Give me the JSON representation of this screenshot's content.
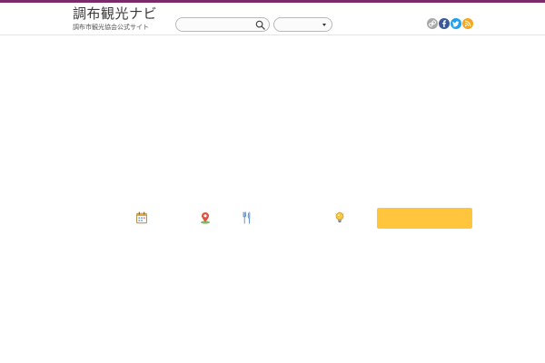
{
  "brand": {
    "stripe_color": "#7b2a6e",
    "title": "調布観光ナビ",
    "subtitle": "調布市観光協会公式サイト"
  },
  "header": {
    "notice": "",
    "search": {
      "placeholder": "",
      "icon": "search-icon"
    },
    "language": {
      "selected": "",
      "icon": "chevron-down-icon"
    },
    "social": [
      {
        "name": "link",
        "icon": "link-icon",
        "color": "#a8a8a8"
      },
      {
        "name": "facebook",
        "icon": "facebook-icon",
        "color": "#3b5998"
      },
      {
        "name": "twitter",
        "icon": "twitter-icon",
        "color": "#1da1f2"
      },
      {
        "name": "rss",
        "icon": "rss-icon",
        "color": "#f5a623"
      }
    ]
  },
  "nav": {
    "items": [
      {
        "label": "",
        "icon": null
      },
      {
        "label": "",
        "icon": "calendar-icon"
      },
      {
        "label": "",
        "icon": "map-pin-icon"
      },
      {
        "label": "",
        "icon": "fork-knife-icon"
      },
      {
        "label": "",
        "icon": null
      },
      {
        "label": "",
        "icon": "lightbulb-icon"
      }
    ],
    "cta": {
      "label": "",
      "sub": "",
      "color": "#ffc53d"
    }
  }
}
